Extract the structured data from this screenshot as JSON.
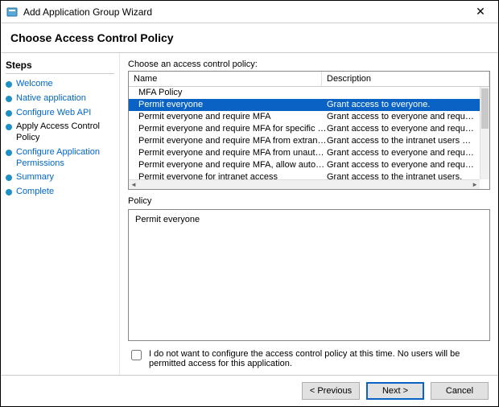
{
  "window": {
    "title": "Add Application Group Wizard",
    "close_glyph": "✕"
  },
  "header": {
    "title": "Choose Access Control Policy"
  },
  "sidebar": {
    "title": "Steps",
    "items": [
      {
        "label": "Welcome",
        "link": true
      },
      {
        "label": "Native application",
        "link": true
      },
      {
        "label": "Configure Web API",
        "link": true
      },
      {
        "label": "Apply Access Control Policy",
        "link": false
      },
      {
        "label": "Configure Application Permissions",
        "link": true
      },
      {
        "label": "Summary",
        "link": true
      },
      {
        "label": "Complete",
        "link": true
      }
    ]
  },
  "main": {
    "choose_label": "Choose an access control policy:",
    "columns": {
      "name": "Name",
      "description": "Description"
    },
    "rows": [
      {
        "name": "MFA Policy",
        "desc": "",
        "selected": false
      },
      {
        "name": "Permit everyone",
        "desc": "Grant access to everyone.",
        "selected": true
      },
      {
        "name": "Permit everyone and require MFA",
        "desc": "Grant access to everyone and require MFA f...",
        "selected": false
      },
      {
        "name": "Permit everyone and require MFA for specific group",
        "desc": "Grant access to everyone and require MFA f...",
        "selected": false
      },
      {
        "name": "Permit everyone and require MFA from extranet access",
        "desc": "Grant access to the intranet users and requir...",
        "selected": false
      },
      {
        "name": "Permit everyone and require MFA from unauthenticated ...",
        "desc": "Grant access to everyone and require MFA f...",
        "selected": false
      },
      {
        "name": "Permit everyone and require MFA, allow automatic devi...",
        "desc": "Grant access to everyone and require MFA f...",
        "selected": false
      },
      {
        "name": "Permit everyone for intranet access",
        "desc": "Grant access to the intranet users.",
        "selected": false
      }
    ],
    "policy_label": "Policy",
    "policy_text": "Permit everyone",
    "optout_label": "I do not want to configure the access control policy at this time.  No users will be permitted access for this application."
  },
  "footer": {
    "previous": "< Previous",
    "next": "Next >",
    "cancel": "Cancel"
  }
}
